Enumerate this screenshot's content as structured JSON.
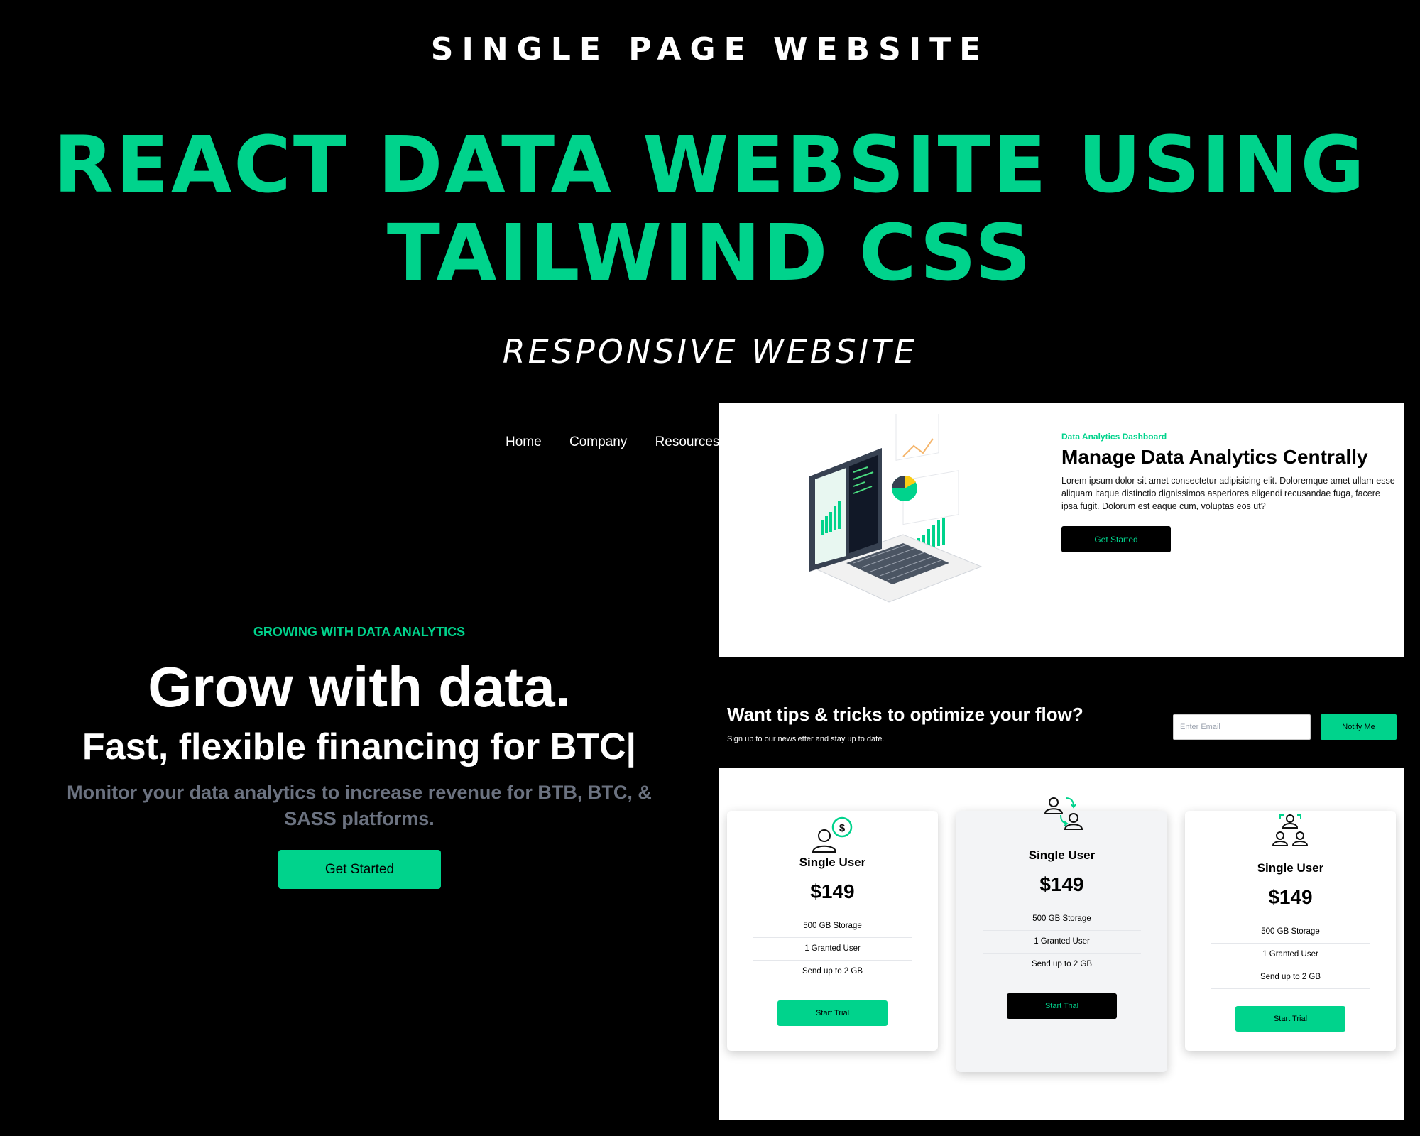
{
  "promo": {
    "kicker": "SINGLE PAGE WEBSITE",
    "headline_line1": "REACT DATA WEBSITE USING",
    "headline_line2": "TAILWIND CSS",
    "tagline": "RESPONSIVE WEBSITE",
    "accent_color": "#00d38c"
  },
  "nav": {
    "items": [
      "Home",
      "Company",
      "Resources"
    ]
  },
  "hero": {
    "eyebrow": "GROWING WITH DATA ANALYTICS",
    "title": "Grow with data.",
    "subtitle": "Fast, flexible financing for BTC|",
    "description": "Monitor your data analytics to increase revenue for BTB, BTC, & SASS platforms.",
    "cta": "Get Started"
  },
  "analytics": {
    "eyebrow": "Data Analytics Dashboard",
    "title": "Manage Data Analytics Centrally",
    "body": "Lorem ipsum dolor sit amet consectetur adipisicing elit. Doloremque amet ullam esse aliquam itaque distinctio dignissimos asperiores eligendi recusandae fuga, facere ipsa fugit. Dolorum est eaque cum, voluptas eos ut?",
    "cta": "Get Started",
    "illustration_icon": "laptop-analytics-illustration"
  },
  "newsletter": {
    "title": "Want tips & tricks to optimize your flow?",
    "subtitle": "Sign up to our newsletter and stay up to date.",
    "email_placeholder": "Enter Email",
    "button": "Notify Me"
  },
  "pricing": {
    "plans": [
      {
        "name": "Single User",
        "price": "$149",
        "features": [
          "500 GB Storage",
          "1 Granted User",
          "Send up to 2 GB"
        ],
        "cta": "Start Trial",
        "icon": "user-dollar-icon",
        "style": "green"
      },
      {
        "name": "Single User",
        "price": "$149",
        "features": [
          "500 GB Storage",
          "1 Granted User",
          "Send up to 2 GB"
        ],
        "cta": "Start Trial",
        "icon": "users-transfer-icon",
        "style": "black"
      },
      {
        "name": "Single User",
        "price": "$149",
        "features": [
          "500 GB Storage",
          "1 Granted User",
          "Send up to 2 GB"
        ],
        "cta": "Start Trial",
        "icon": "team-users-icon",
        "style": "green"
      }
    ]
  }
}
